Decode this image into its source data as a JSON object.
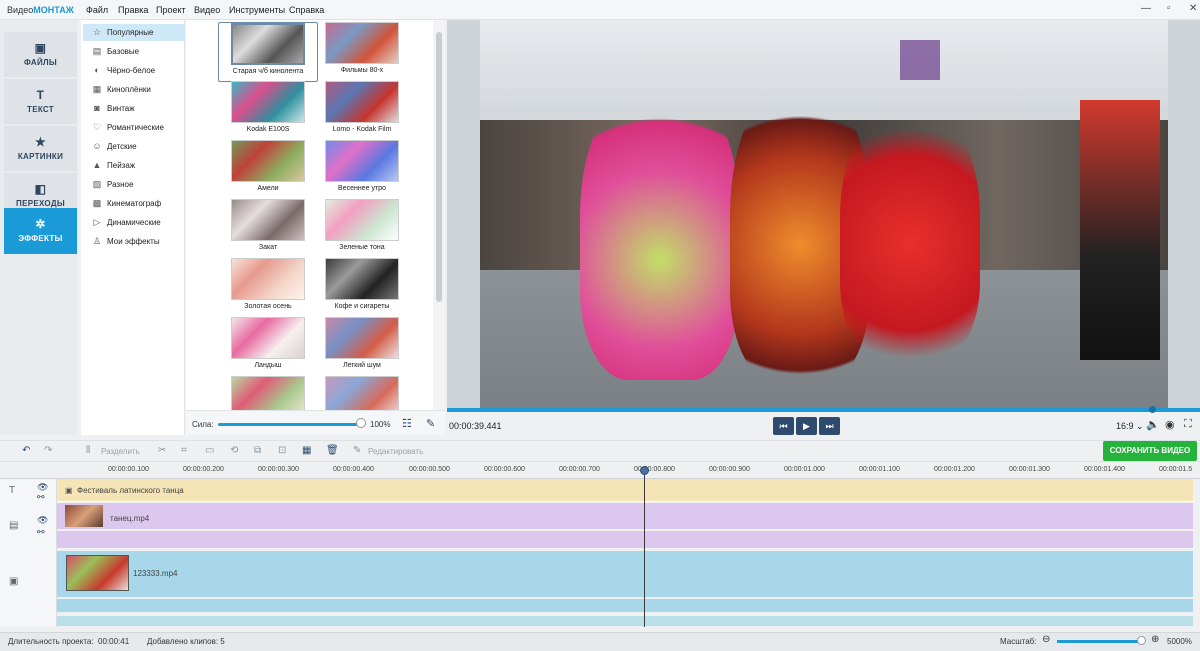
{
  "app": {
    "logo_a": "Видео",
    "logo_b": "МОНТАЖ"
  },
  "menu": [
    "Файл",
    "Правка",
    "Проект",
    "Видео",
    "Инструменты",
    "Справка"
  ],
  "tabs": [
    {
      "label": "ФАЙЛЫ",
      "icon": "image-icon"
    },
    {
      "label": "ТЕКСТ",
      "icon": "text-icon"
    },
    {
      "label": "КАРТИНКИ",
      "icon": "star-icon"
    },
    {
      "label": "ПЕРЕХОДЫ",
      "icon": "transitions-icon"
    },
    {
      "label": "ЭФФЕКТЫ",
      "icon": "effects-wand-icon"
    }
  ],
  "categories": [
    "Популярные",
    "Базовые",
    "Чёрно-белое",
    "Киноплёнки",
    "Винтаж",
    "Романтические",
    "Детские",
    "Пейзаж",
    "Разное",
    "Кинематограф",
    "Динамические",
    "Мои эффекты"
  ],
  "effects": [
    "Старая ч/б кинолента",
    "Фильмы 80-х",
    "Kodak E100S",
    "Lomo - Kodak Film",
    "Амели",
    "Весеннее утро",
    "Закат",
    "Зеленые тона",
    "Золотая осень",
    "Кофе и сигареты",
    "Ландыш",
    "Легкий шум",
    "",
    ""
  ],
  "power": {
    "label": "Сила:",
    "value": "100%",
    "level": 1.0
  },
  "player": {
    "time": "00:00:39.441",
    "aspect": "16:9 ⌄",
    "progress": 0.94
  },
  "toolbar": {
    "split": "Разделить",
    "edit": "Редактировать",
    "save": "СОХРАНИТЬ ВИДЕО"
  },
  "ruler": [
    "00:00:00.100",
    "00:00:00.200",
    "00:00:00.300",
    "00:00:00.400",
    "00:00:00.500",
    "00:00:00.600",
    "00:00:00.700",
    "00:00:00.800",
    "00:00:00.900",
    "00:00:01.000",
    "00:00:01.100",
    "00:00:01.200",
    "00:00:01.300",
    "00:00:01.400",
    "00:00:01.5"
  ],
  "tracks": {
    "text_clip": "Фестиваль латинского танца",
    "clip1": "танец.mp4",
    "clip2": "123333.mp4"
  },
  "status": {
    "duration_label": "Длительность проекта:",
    "duration": "00:00:41",
    "clips": "Добавлено клипов: 5",
    "zoom_label": "Масштаб:",
    "zoom_value": "5000%"
  },
  "colors": {
    "accent": "#1a9ad6",
    "save": "#25b33c",
    "tab_active": "#1a9ad6"
  }
}
